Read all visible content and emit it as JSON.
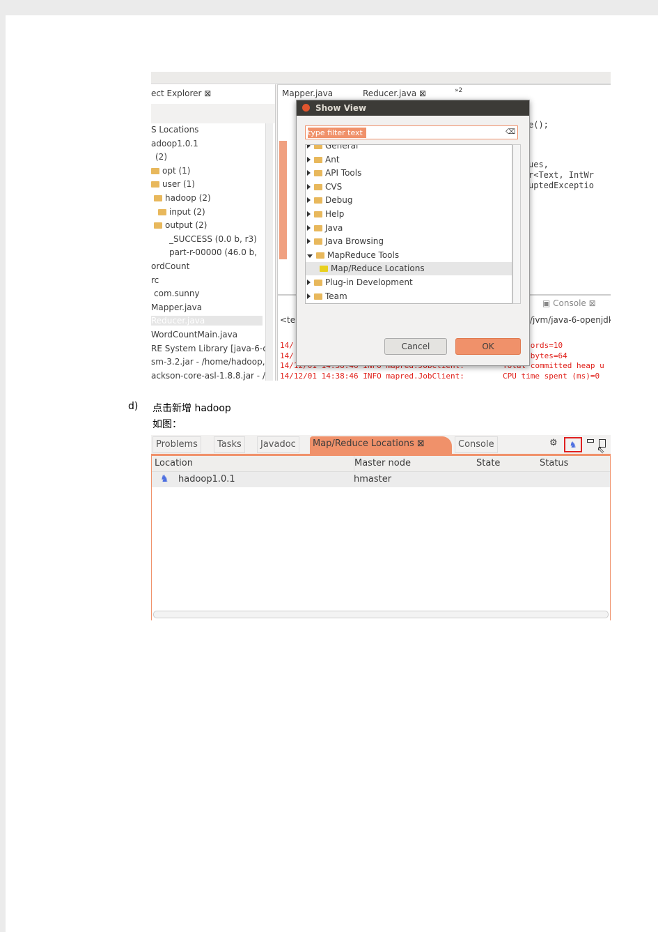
{
  "screenshot1": {
    "project_explorer": {
      "tab_label": "ect Explorer",
      "items": [
        "S Locations",
        "adoop1.0.1",
        "(2)",
        "opt (1)",
        "user (1)",
        "hadoop (2)",
        "input (2)",
        "output (2)",
        "_SUCCESS (0.0 b, r3)",
        "part-r-00000 (46.0 b,",
        "ordCount",
        "rc",
        "com.sunny",
        "Mapper.java",
        "Reducer.java",
        "WordCountMain.java",
        "RE System Library [java-6-o",
        "sm-3.2.jar - /home/hadoop,",
        "ackson-core-asl-1.8.8.jar - /h"
      ]
    },
    "editor_tabs": [
      "Mapper.java",
      "Reducer.java",
      "»2"
    ],
    "code_lines": [
      "e();",
      "ues,",
      "r<Text, IntWr",
      "uptedExceptio"
    ],
    "console": {
      "tab_label": "Console",
      "path": "/jvm/java-6-openjdk",
      "left_label": "<ter",
      "lines": [
        [
          "14/",
          "ed Records=10"
        ],
        [
          "14/",
          "utput bytes=64"
        ],
        [
          "14/12/01 14:38:46 INFO mapred.JobClient:",
          "Total committed heap u"
        ],
        [
          "14/12/01 14:38:46 INFO mapred.JobClient:",
          "CPU time spent (ms)=0"
        ]
      ]
    },
    "dialog": {
      "title": "Show View",
      "filter_placeholder": "type filter text",
      "items": [
        {
          "label": "General",
          "expanded": false
        },
        {
          "label": "Ant",
          "expanded": false
        },
        {
          "label": "API Tools",
          "expanded": false
        },
        {
          "label": "CVS",
          "expanded": false
        },
        {
          "label": "Debug",
          "expanded": false
        },
        {
          "label": "Help",
          "expanded": false
        },
        {
          "label": "Java",
          "expanded": false
        },
        {
          "label": "Java Browsing",
          "expanded": false
        },
        {
          "label": "MapReduce Tools",
          "expanded": true
        },
        {
          "label": "Map/Reduce Locations",
          "child": true,
          "selected": true
        },
        {
          "label": "Plug-in Development",
          "expanded": false
        },
        {
          "label": "Team",
          "expanded": false
        }
      ],
      "cancel": "Cancel",
      "ok": "OK"
    }
  },
  "step": {
    "marker": "d)",
    "text": "点击新增 hadoop",
    "sub": "如图："
  },
  "screenshot2": {
    "tabs": [
      "Problems",
      "Tasks",
      "Javadoc",
      "Map/Reduce Locations",
      "Console"
    ],
    "active_tab": "Map/Reduce Locations",
    "columns": [
      "Location",
      "Master node",
      "State",
      "Status"
    ],
    "rows": [
      [
        "hadoop1.0.1",
        "hmaster",
        "",
        ""
      ]
    ]
  },
  "colors": {
    "accent": "#f0916a",
    "highlight_box": "#e02020",
    "console_text": "#e0201a"
  }
}
